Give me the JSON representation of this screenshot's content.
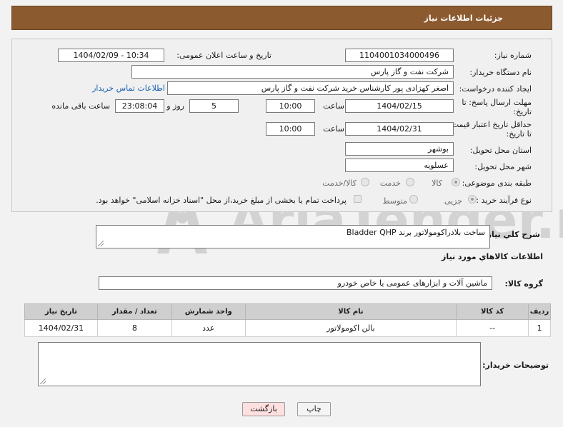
{
  "header": {
    "title": "جزئیات اطلاعات نیاز"
  },
  "form": {
    "need_number_label": "شماره نیاز:",
    "need_number": "1104001034000496",
    "announce_label": "تاریخ و ساعت اعلان عمومی:",
    "announce_value": "1404/02/09 - 10:34",
    "buyer_org_label": "نام دستگاه خریدار:",
    "buyer_org": "شرکت نفت و گاز پارس",
    "creator_label": "ایجاد کننده درخواست:",
    "creator": "اصغر کهزادی پور کارشناس خرید شرکت نفت و گاز پارس",
    "contact_link": "اطلاعات تماس خریدار",
    "deadline_label_1": "مهلت ارسال پاسخ: تا",
    "deadline_label_2": "تاریخ:",
    "deadline_date": "1404/02/15",
    "time_label": "ساعت",
    "deadline_time": "10:00",
    "days_value": "5",
    "days_label": "روز و",
    "remaining_time": "23:08:04",
    "remaining_label": "ساعت باقی مانده",
    "validity_label_1": "حداقل تاریخ اعتبار قیمت:",
    "validity_label_2": "تا تاریخ:",
    "validity_date": "1404/02/31",
    "validity_time_label": "ساعت",
    "validity_time": "10:00",
    "province_label": "استان محل تحویل:",
    "province": "بوشهر",
    "city_label": "شهر محل تحویل:",
    "city": "عسلویه",
    "category_label": "طبقه بندی موضوعی:",
    "category_options": [
      "کالا",
      "خدمت",
      "کالا/خدمت"
    ],
    "process_label": "نوع فرآیند خرید :",
    "process_options": [
      "جزیی",
      "متوسط"
    ],
    "payment_note": "پرداخت تمام یا بخشی از مبلغ خرید،از محل \"اسناد خزانه اسلامی\" خواهد بود."
  },
  "description": {
    "label": "شرح کلي نياز:",
    "value": "ساخت بلادراکومولاتور برند  Bladder QHP"
  },
  "goods_section": {
    "title": "اطلاعات کالاهاي مورد نياز",
    "group_label": "گروه کالا:",
    "group_value": "ماشین آلات و ابزارهای عمومی یا خاص خودرو"
  },
  "table": {
    "headers": [
      "ردیف",
      "کد کالا",
      "نام کالا",
      "واحد شمارش",
      "تعداد / مقدار",
      "تاریخ نیاز"
    ],
    "rows": [
      {
        "index": "1",
        "code": "--",
        "name": "بالن اکومولاتور",
        "unit": "عدد",
        "qty": "8",
        "date": "1404/02/31"
      }
    ]
  },
  "buyer_notes": {
    "label": "توضیحات خریدار:",
    "value": ""
  },
  "buttons": {
    "print": "چاپ",
    "back": "بازگشت"
  },
  "watermark": {
    "text": "AriaTender.neT"
  },
  "colors": {
    "header_bg": "#8c5a2f",
    "link": "#1a5fb4",
    "back_button_bg": "#ffe0e0"
  }
}
